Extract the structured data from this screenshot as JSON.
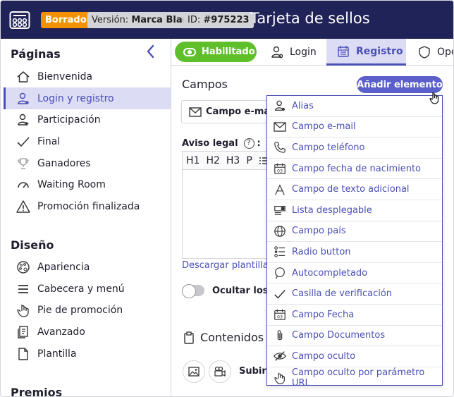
{
  "header": {
    "status_badge": "Borrador",
    "version_label": "Versión:",
    "version_value": "Marca Blanca",
    "id_label": "ID:",
    "id_value": "#975223",
    "title": "Tarjeta de sellos"
  },
  "sidebar": {
    "pages_title": "Páginas",
    "pages": [
      {
        "label": "Bienvenida",
        "icon": "home-icon"
      },
      {
        "label": "Login y registro",
        "icon": "user-icon",
        "active": true
      },
      {
        "label": "Participación",
        "icon": "user-plus-icon"
      },
      {
        "label": "Final",
        "icon": "check-icon"
      },
      {
        "label": "Ganadores",
        "icon": "trophy-icon"
      },
      {
        "label": "Waiting Room",
        "icon": "gauge-icon"
      },
      {
        "label": "Promoción finalizada",
        "icon": "warning-icon"
      }
    ],
    "design_title": "Diseño",
    "design": [
      {
        "label": "Apariencia",
        "icon": "palette-icon"
      },
      {
        "label": "Cabecera y menú",
        "icon": "menu-icon"
      },
      {
        "label": "Pie de promoción",
        "icon": "hand-icon"
      },
      {
        "label": "Avanzado",
        "icon": "advanced-icon"
      },
      {
        "label": "Plantilla",
        "icon": "file-icon"
      }
    ],
    "prizes_title": "Premios"
  },
  "tabs": {
    "enabled_label": "Habilitado",
    "login_label": "Login",
    "registro_label": "Registro",
    "options_label": "Opc"
  },
  "main": {
    "fields_title": "Campos",
    "add_button": "Añadir elemento",
    "field_card_label": "Campo e-mail",
    "legal_label": "Aviso legal",
    "legal_help": "?",
    "legal_colon": ":",
    "toolbar": [
      "H1",
      "H2",
      "H3",
      "P"
    ],
    "download_link": "Descargar plantilla",
    "hide_label": "Ocultar los c",
    "contents_title": "Contenidos",
    "upload_label": "Subir i"
  },
  "dropdown": [
    {
      "label": "Alias",
      "icon": "user-icon"
    },
    {
      "label": "Campo e-mail",
      "icon": "mail-icon"
    },
    {
      "label": "Campo teléfono",
      "icon": "phone-icon"
    },
    {
      "label": "Campo fecha de nacimiento",
      "icon": "calendar-icon"
    },
    {
      "label": "Campo de texto adicional",
      "icon": "text-icon"
    },
    {
      "label": "Lista desplegable",
      "icon": "dropdown-list-icon"
    },
    {
      "label": "Campo país",
      "icon": "globe-icon"
    },
    {
      "label": "Radio button",
      "icon": "radio-list-icon"
    },
    {
      "label": "Autocompletado",
      "icon": "autocomplete-icon"
    },
    {
      "label": "Casilla de verificación",
      "icon": "check-icon"
    },
    {
      "label": "Campo Fecha",
      "icon": "calendar-icon"
    },
    {
      "label": "Campo Documentos",
      "icon": "paperclip-icon"
    },
    {
      "label": "Campo oculto",
      "icon": "eye-off-icon"
    },
    {
      "label": "Campo oculto por parámetro URL",
      "icon": "hand-icon"
    }
  ],
  "colors": {
    "header_bg": "#202357",
    "accent": "#4a4fb6",
    "draft_badge": "#f39200",
    "enabled_green": "#5fbf2a"
  }
}
